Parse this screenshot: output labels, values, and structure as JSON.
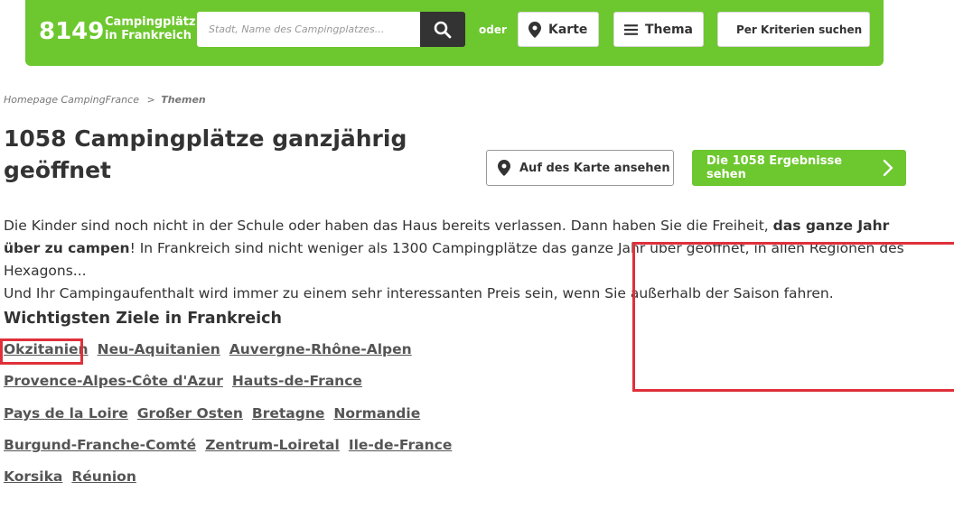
{
  "header": {
    "count": "8149",
    "count_label_line1": "Campingplätz",
    "count_label_line2": "in Frankreich",
    "search_placeholder": "Stadt, Name des Campingplatzes...",
    "oder": "oder",
    "map_button": "Karte",
    "theme_button": "Thema",
    "criteria_button": "Per Kriterien suchen"
  },
  "breadcrumb": {
    "home": "Homepage CampingFrance",
    "separator": ">",
    "current": "Themen"
  },
  "page": {
    "title": "1058 Campingplätze ganzjährig geöffnet",
    "map_view_button": "Auf des Karte ansehen",
    "results_button": "Die 1058 Ergebnisse sehen"
  },
  "intro": {
    "part1": "Die Kinder sind noch nicht in der Schule oder haben das Haus bereits verlassen. Dann haben Sie die Freiheit, ",
    "bold": "das ganze Jahr über zu campen",
    "part2": "! In Frankreich sind nicht weniger als 1300 Campingplätze das ganze Jahr über geöffnet, in allen Regionen des Hexagons...",
    "part3": "Und Ihr Campingaufenthalt wird immer zu einem sehr interessanten Preis sein, wenn Sie außerhalb der Saison fahren."
  },
  "destinations": {
    "title": "Wichtigsten Ziele in Frankreich",
    "rows": [
      [
        "Okzitanien",
        "Neu-Aquitanien",
        "Auvergne-Rhône-Alpen"
      ],
      [
        "Provence-Alpes-Côte d'Azur",
        "Hauts-de-France"
      ],
      [
        "Pays de la Loire",
        "Großer Osten",
        "Bretagne",
        "Normandie"
      ],
      [
        "Burgund-Franche-Comté",
        "Zentrum-Loiretal",
        "Ile-de-France"
      ],
      [
        "Korsika",
        "Réunion"
      ]
    ]
  },
  "colors": {
    "brand_green": "#6dc72e",
    "dark": "#333333",
    "annotation_red": "#e0303b"
  }
}
